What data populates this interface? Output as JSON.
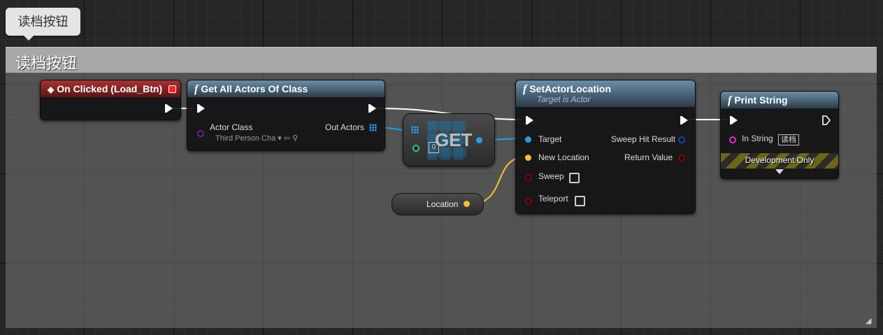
{
  "comment_tab": "读档按钮",
  "comment_title": "读档按钮",
  "nodes": {
    "on_clicked": {
      "title": "On Clicked (Load_Btn)"
    },
    "get_all_actors": {
      "title": "Get All Actors Of Class",
      "actor_class_label": "Actor Class",
      "actor_class_value": "Third Person Cha",
      "out_actors_label": "Out Actors"
    },
    "get": {
      "title": "GET",
      "index": "0"
    },
    "location": {
      "label": "Location"
    },
    "set_actor_location": {
      "title": "SetActorLocation",
      "subtitle": "Target is Actor",
      "target": "Target",
      "new_location": "New Location",
      "sweep": "Sweep",
      "teleport": "Teleport",
      "sweep_hit_result": "Sweep Hit Result",
      "return_value": "Return Value"
    },
    "print_string": {
      "title": "Print String",
      "in_string_label": "In String",
      "in_string_value": "读档",
      "dev_only": "Development Only"
    }
  },
  "colors": {
    "exec": "#ffffff",
    "object": "#1ea0ee",
    "vector": "#f7c02c",
    "bool": "#8b0000",
    "string": "#e52bd0",
    "class": "#6a1fb0",
    "int": "#1ed690"
  },
  "icons": [
    "event-diamond-icon",
    "function-icon",
    "exec-pin-icon",
    "array-pin-icon",
    "search-icon",
    "dropdown-arrow-icon",
    "expand-arrow-icon",
    "resize-grip-icon"
  ]
}
